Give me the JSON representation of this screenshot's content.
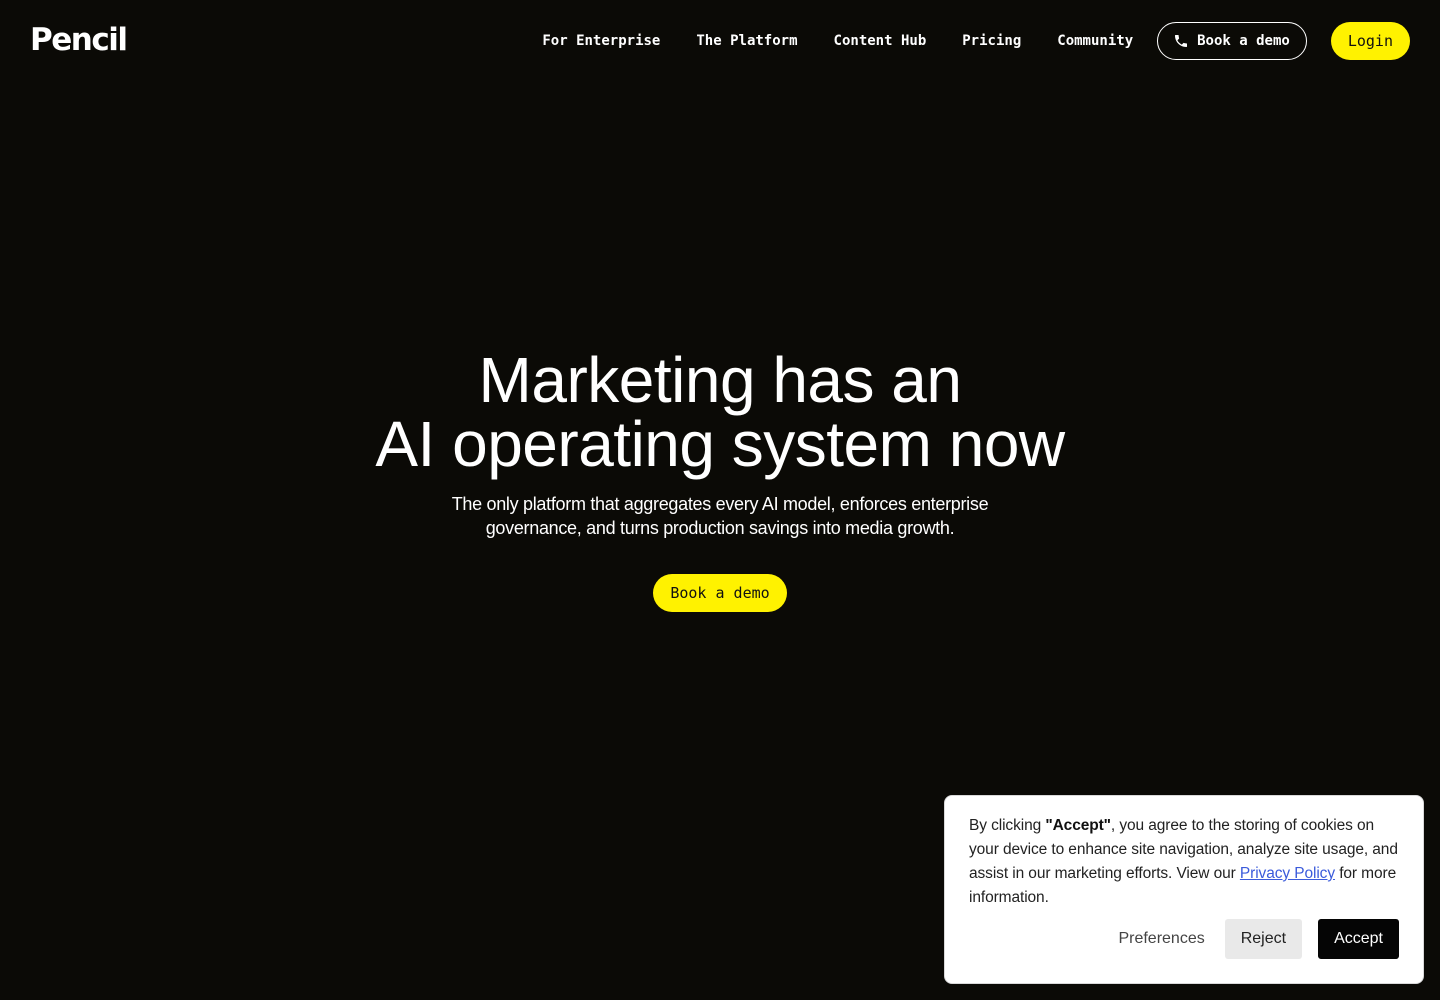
{
  "header": {
    "logo": "Pencil",
    "nav": [
      {
        "label": "For Enterprise"
      },
      {
        "label": "The Platform"
      },
      {
        "label": "Content Hub"
      },
      {
        "label": "Pricing"
      },
      {
        "label": "Community"
      }
    ],
    "demo_button": {
      "label": "Book a demo",
      "icon": "phone-icon"
    },
    "login_button": {
      "label": "Login"
    }
  },
  "hero": {
    "title_line1": "Marketing has an",
    "title_line2": "AI operating system now",
    "subtitle_line1": "The only platform that aggregates every AI model, enforces enterprise",
    "subtitle_line2": "governance, and turns production savings into media growth.",
    "cta_label": "Book a demo"
  },
  "cookie_banner": {
    "text_prefix": "By clicking ",
    "text_bold": "\"Accept\"",
    "text_middle": ", you agree to the storing of cookies on your device to enhance site navigation, analyze site usage, and assist in our marketing efforts. View our ",
    "link_label": "Privacy Policy",
    "text_suffix": " for more information.",
    "preferences_label": "Preferences",
    "reject_label": "Reject",
    "accept_label": "Accept"
  },
  "colors": {
    "background": "#0b0a06",
    "accent_yellow": "#fff200",
    "link_blue": "#3b5bdb"
  }
}
